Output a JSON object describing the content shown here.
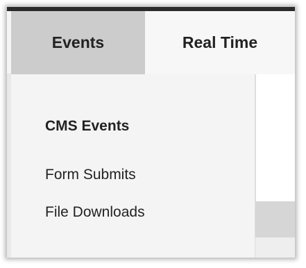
{
  "nav": {
    "items": [
      {
        "label": "Events",
        "active": true
      },
      {
        "label": "Real Time",
        "active": false
      }
    ]
  },
  "dropdown": {
    "heading": "CMS Events",
    "items": [
      {
        "label": "Form Submits"
      },
      {
        "label": "File Downloads"
      }
    ]
  },
  "colors": {
    "active_tab": "#cccccc",
    "nav_background": "#f5f5f5",
    "dropdown_background": "#f4f4f4",
    "top_line": "#2b2b2b",
    "text": "#222222"
  }
}
